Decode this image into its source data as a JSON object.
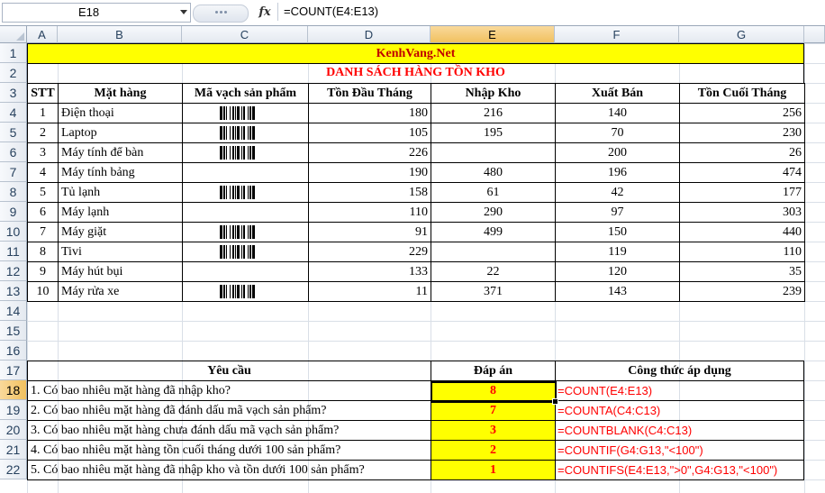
{
  "formula_bar": {
    "name_box": "E18",
    "fx": "fx",
    "formula": "=COUNT(E4:E13)"
  },
  "columns": [
    "A",
    "B",
    "C",
    "D",
    "E",
    "F",
    "G"
  ],
  "rows": [
    "1",
    "2",
    "3",
    "4",
    "5",
    "6",
    "7",
    "8",
    "9",
    "10",
    "11",
    "12",
    "13",
    "14",
    "15",
    "16",
    "17",
    "18",
    "19",
    "20",
    "21",
    "22"
  ],
  "sheet": {
    "site_title": "KenhVang.Net",
    "table_title": "DANH SÁCH HÀNG TỒN KHO",
    "headers": [
      "STT",
      "Mặt hàng",
      "Mã vạch sản phẩm",
      "Tồn Đầu Tháng",
      "Nhập Kho",
      "Xuất Bán",
      "Tồn Cuối Tháng"
    ],
    "items": [
      {
        "stt": "1",
        "name": "Điện thoại",
        "barcode": true,
        "ton_dau": "180",
        "nhap": "216",
        "xuat": "140",
        "ton_cuoi": "256"
      },
      {
        "stt": "2",
        "name": "Laptop",
        "barcode": true,
        "ton_dau": "105",
        "nhap": "195",
        "xuat": "70",
        "ton_cuoi": "230"
      },
      {
        "stt": "3",
        "name": "Máy tính để bàn",
        "barcode": true,
        "ton_dau": "226",
        "nhap": "",
        "xuat": "200",
        "ton_cuoi": "26"
      },
      {
        "stt": "4",
        "name": "Máy tính bảng",
        "barcode": false,
        "ton_dau": "190",
        "nhap": "480",
        "xuat": "196",
        "ton_cuoi": "474"
      },
      {
        "stt": "5",
        "name": "Tủ lạnh",
        "barcode": true,
        "ton_dau": "158",
        "nhap": "61",
        "xuat": "42",
        "ton_cuoi": "177"
      },
      {
        "stt": "6",
        "name": "Máy lạnh",
        "barcode": false,
        "ton_dau": "110",
        "nhap": "290",
        "xuat": "97",
        "ton_cuoi": "303"
      },
      {
        "stt": "7",
        "name": "Máy giặt",
        "barcode": true,
        "ton_dau": "91",
        "nhap": "499",
        "xuat": "150",
        "ton_cuoi": "440"
      },
      {
        "stt": "8",
        "name": "Tivi",
        "barcode": true,
        "ton_dau": "229",
        "nhap": "",
        "xuat": "119",
        "ton_cuoi": "110"
      },
      {
        "stt": "9",
        "name": "Máy hút bụi",
        "barcode": false,
        "ton_dau": "133",
        "nhap": "22",
        "xuat": "120",
        "ton_cuoi": "35"
      },
      {
        "stt": "10",
        "name": "Máy rửa xe",
        "barcode": true,
        "ton_dau": "11",
        "nhap": "371",
        "xuat": "143",
        "ton_cuoi": "239"
      }
    ],
    "questions_header": {
      "q": "Yêu cầu",
      "a": "Đáp án",
      "f": "Công thức áp dụng"
    },
    "questions": [
      {
        "q": "1. Có bao nhiêu mặt hàng đã nhập kho?",
        "a": "8",
        "f": "=COUNT(E4:E13)"
      },
      {
        "q": "2. Có bao nhiêu mặt hàng đã đánh dấu mã vạch sản phẩm?",
        "a": "7",
        "f": "=COUNTA(C4:C13)"
      },
      {
        "q": "3. Có bao nhiêu mặt hàng chưa đánh dấu mã vạch sản phẩm?",
        "a": "3",
        "f": "=COUNTBLANK(C4:C13)"
      },
      {
        "q": "4. Có bao nhiêu mặt hàng tồn cuối tháng dưới 100 sản phẩm?",
        "a": "2",
        "f": "=COUNTIF(G4:G13,\"<100\")"
      },
      {
        "q": "5. Có bao nhiêu mặt hàng đã nhập kho và tồn dưới 100 sản phẩm?",
        "a": "1",
        "f": "=COUNTIFS(E4:E13,\">0\",G4:G13,\"<100\")"
      }
    ]
  },
  "colors": {
    "title_fill": "#ffff00",
    "title_text": "#c00000",
    "accent_red": "#ff0000",
    "header_selected": "#f1c15f"
  }
}
